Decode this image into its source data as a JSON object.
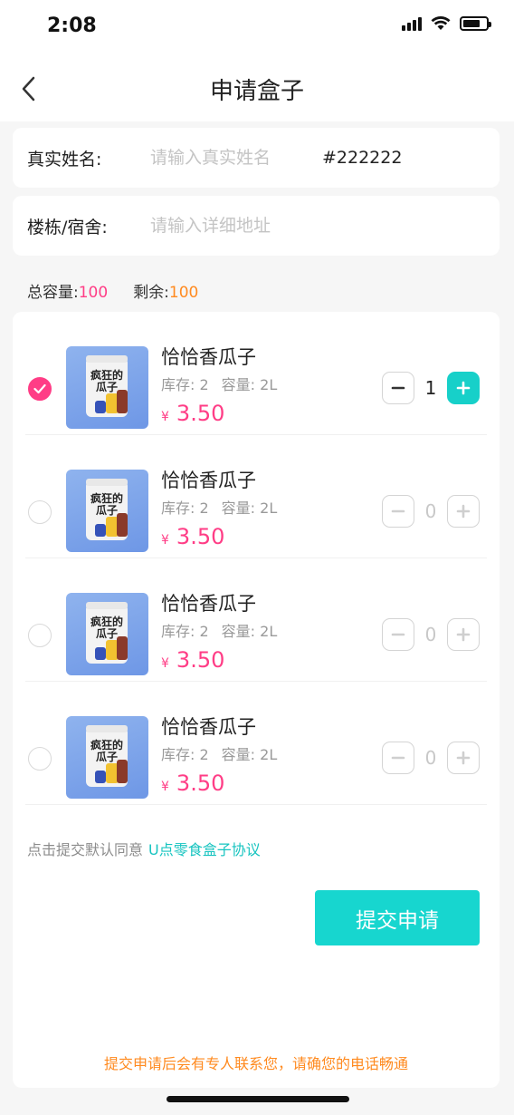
{
  "status": {
    "time": "2:08"
  },
  "nav": {
    "title": "申请盒子"
  },
  "form": {
    "name_label": "真实姓名:",
    "name_placeholder": "请输入真实姓名",
    "name_color": "#222222",
    "address_label": "楼栋/宿舍:",
    "address_placeholder": "请输入详细地址"
  },
  "capacity": {
    "total_label": "总容量:",
    "total_value": "100",
    "remaining_label": "剩余:",
    "remaining_value": "100"
  },
  "products": [
    {
      "name": "恰恰香瓜子",
      "stock_label": "库存: 2",
      "capacity_label": "容量: 2L",
      "currency": "¥",
      "price": "3.50",
      "quantity": "1",
      "checked": true,
      "package_text": "疯狂的瓜子"
    },
    {
      "name": "恰恰香瓜子",
      "stock_label": "库存: 2",
      "capacity_label": "容量: 2L",
      "currency": "¥",
      "price": "3.50",
      "quantity": "0",
      "checked": false,
      "package_text": "疯狂的瓜子"
    },
    {
      "name": "恰恰香瓜子",
      "stock_label": "库存: 2",
      "capacity_label": "容量: 2L",
      "currency": "¥",
      "price": "3.50",
      "quantity": "0",
      "checked": false,
      "package_text": "疯狂的瓜子"
    },
    {
      "name": "恰恰香瓜子",
      "stock_label": "库存: 2",
      "capacity_label": "容量: 2L",
      "currency": "¥",
      "price": "3.50",
      "quantity": "0",
      "checked": false,
      "package_text": "疯狂的瓜子"
    }
  ],
  "agreement": {
    "prefix": "点击提交默认同意",
    "link": "U点零食盒子协议"
  },
  "submit_label": "提交申请",
  "footer_note": "提交申请后会有专人联系您，请确您的电话畅通",
  "colors": {
    "accent_teal": "#17d6cf",
    "accent_pink": "#ff3d86",
    "accent_orange": "#ff8a1f"
  },
  "icons": {
    "back": "chevron-left-icon",
    "check": "check-icon",
    "minus": "minus-icon",
    "plus": "plus-icon"
  }
}
